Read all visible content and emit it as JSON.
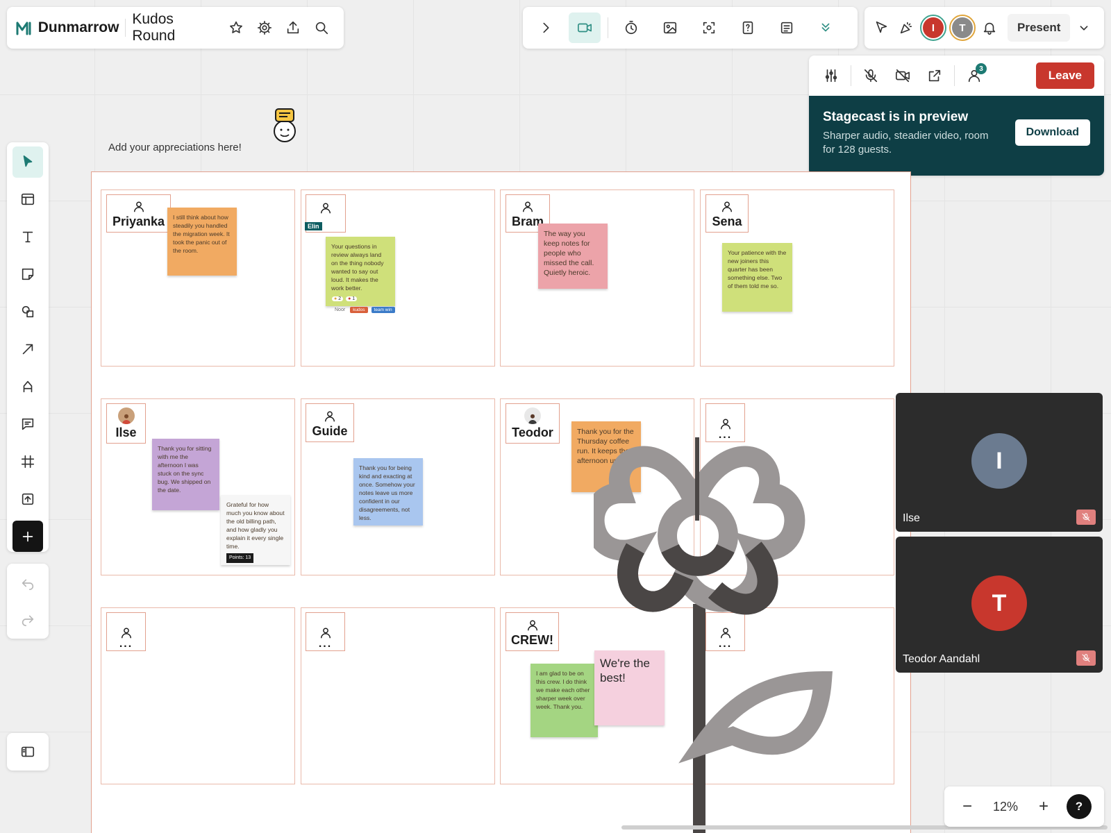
{
  "app": {
    "brand": "Dunmarrow",
    "board_title": "Kudos Round",
    "brand_color": "#1d7a73"
  },
  "collab_toolbar": {
    "icons": [
      "chevron-right-icon",
      "video-icon",
      "timer-icon",
      "image-icon",
      "focus-icon",
      "card-icon",
      "notes-icon",
      "chevron-double-down-icon"
    ]
  },
  "session": {
    "avatars": [
      {
        "initial": "I",
        "color": "#c8372d",
        "ring": "#3fa38f"
      },
      {
        "initial": "T",
        "color": "#8a8a8a",
        "ring": "#e0a53b"
      }
    ],
    "present_label": "Present"
  },
  "call": {
    "participants_count": "3",
    "leave_label": "Leave",
    "preview_title": "Stagecast is in preview",
    "preview_text": "Sharper audio, steadier video, room for 128 guests.",
    "download_label": "Download",
    "tiles": [
      {
        "name": "Ilse",
        "initial": "I",
        "color": "#6b7b90"
      },
      {
        "name": "Teodor Aandahl",
        "initial": "T",
        "color": "#c8372d"
      }
    ]
  },
  "canvas": {
    "caption": "Add your appreciations here!",
    "cells": [
      {
        "name": "Priyanka"
      },
      {
        "name": "",
        "tag": "Elin"
      },
      {
        "name": "Bram"
      },
      {
        "name": "Sena"
      },
      {
        "name": "Ilse"
      },
      {
        "name": "Guide"
      },
      {
        "name": "Teodor"
      },
      {
        "name": "..."
      },
      {
        "name": "..."
      },
      {
        "name": "..."
      },
      {
        "name": "CREW!"
      },
      {
        "name": "..."
      }
    ],
    "stickies": {
      "priyanka": "I still think about how steadily you handled the migration week. It took the panic out of the room.",
      "elin": "Your questions in review always land on the thing nobody wanted to say out loud. It makes the work better.",
      "elin_reactions": [
        "2",
        "1"
      ],
      "elin_author": "Noor",
      "elin_tags": [
        "kudos",
        "team win"
      ],
      "bram": "The way you keep notes for people who missed the call. Quietly heroic.",
      "sena": "Your patience with the new joiners this quarter has been something else. Two of them told me so.",
      "ilse_1": "Thank you for sitting with me the afternoon I was stuck on the sync bug. We shipped on the date.",
      "ilse_2": "Grateful for how much you know about the old billing path, and how gladly you explain it every single time.",
      "ilse_2_points": "Points: 13",
      "guide": "Thank you for being kind and exacting at once. Somehow your notes leave us more confident in our disagreements, not less.",
      "teodor": "Thank you for the Thursday coffee run. It keeps the afternoon upright.",
      "crew_1": "I am glad to be on this crew. I do think we make each other sharper week over week. Thank you.",
      "crew_2": "We're the best!"
    }
  },
  "zoom": {
    "value": "12%",
    "minus": "−",
    "plus": "+",
    "help": "?"
  }
}
